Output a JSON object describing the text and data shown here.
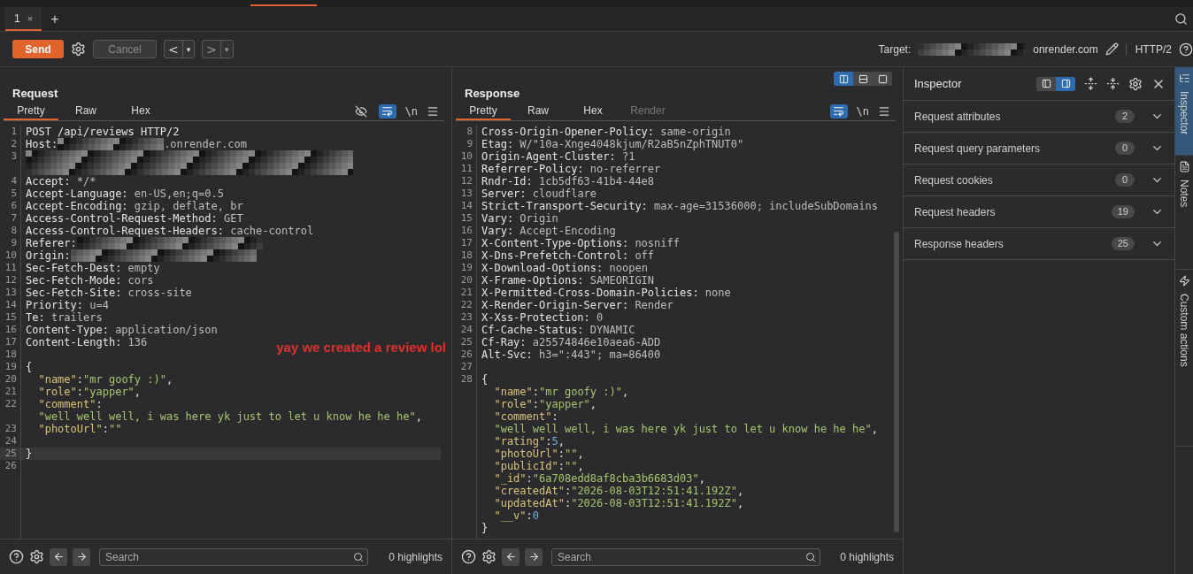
{
  "tabs": [
    {
      "label": "1",
      "close": "×",
      "selected": true
    }
  ],
  "new_tab": "+",
  "toolbar": {
    "send": "Send",
    "cancel": {
      "label": "Cancel",
      "disabled": true
    },
    "back": "<",
    "forward": ">",
    "dropdown": "▾",
    "target_label": "Target:",
    "target_host": "onrender.com",
    "protocol": "HTTP/2"
  },
  "request": {
    "title": "Request",
    "tabs": [
      {
        "label": "Pretty",
        "selected": true,
        "disabled": false
      },
      {
        "label": "Raw",
        "selected": false,
        "disabled": false
      },
      {
        "label": "Hex",
        "selected": false,
        "disabled": false
      }
    ],
    "hide_nonprintable": true,
    "wrap_on": true,
    "newline_label": "\\n",
    "lines": [
      {
        "num": "1",
        "highlighted": false,
        "parts": [
          {
            "kind": "name",
            "t": "POST /api/reviews HTTP/2"
          }
        ]
      },
      {
        "num": "2",
        "highlighted": false,
        "parts": [
          {
            "kind": "name",
            "t": "Host:"
          },
          {
            "kind": "redacted"
          },
          {
            "kind": "value",
            "t": ".onrender.com"
          }
        ]
      },
      {
        "num": "3",
        "highlighted": false,
        "parts": [
          {
            "kind": "redacted"
          }
        ]
      },
      {
        "num": "4",
        "highlighted": false,
        "parts": [
          {
            "kind": "name",
            "t": "Accept:"
          },
          {
            "kind": "value",
            "t": " */*"
          }
        ]
      },
      {
        "num": "5",
        "highlighted": false,
        "parts": [
          {
            "kind": "name",
            "t": "Accept-Language:"
          },
          {
            "kind": "value",
            "t": " en-US,en;q=0.5"
          }
        ]
      },
      {
        "num": "6",
        "highlighted": false,
        "parts": [
          {
            "kind": "name",
            "t": "Accept-Encoding:"
          },
          {
            "kind": "value",
            "t": " gzip, deflate, br"
          }
        ]
      },
      {
        "num": "7",
        "highlighted": false,
        "parts": [
          {
            "kind": "name",
            "t": "Access-Control-Request-Method:"
          },
          {
            "kind": "value",
            "t": " GET"
          }
        ]
      },
      {
        "num": "8",
        "highlighted": false,
        "parts": [
          {
            "kind": "name",
            "t": "Access-Control-Request-Headers:"
          },
          {
            "kind": "value",
            "t": " cache-control"
          }
        ]
      },
      {
        "num": "9",
        "highlighted": false,
        "parts": [
          {
            "kind": "name",
            "t": "Referer:"
          },
          {
            "kind": "redacted"
          }
        ]
      },
      {
        "num": "10",
        "highlighted": false,
        "parts": [
          {
            "kind": "name",
            "t": "Origin:"
          },
          {
            "kind": "redacted"
          }
        ]
      },
      {
        "num": "11",
        "highlighted": false,
        "parts": [
          {
            "kind": "name",
            "t": "Sec-Fetch-Dest:"
          },
          {
            "kind": "value",
            "t": " empty"
          }
        ]
      },
      {
        "num": "12",
        "highlighted": false,
        "parts": [
          {
            "kind": "name",
            "t": "Sec-Fetch-Mode:"
          },
          {
            "kind": "value",
            "t": " cors"
          }
        ]
      },
      {
        "num": "13",
        "highlighted": false,
        "parts": [
          {
            "kind": "name",
            "t": "Sec-Fetch-Site:"
          },
          {
            "kind": "value",
            "t": " cross-site"
          }
        ]
      },
      {
        "num": "14",
        "highlighted": false,
        "parts": [
          {
            "kind": "name",
            "t": "Priority:"
          },
          {
            "kind": "value",
            "t": " u=4"
          }
        ]
      },
      {
        "num": "15",
        "highlighted": false,
        "parts": [
          {
            "kind": "name",
            "t": "Te:"
          },
          {
            "kind": "value",
            "t": " trailers"
          }
        ]
      },
      {
        "num": "16",
        "highlighted": false,
        "parts": [
          {
            "kind": "name",
            "t": "Content-Type:"
          },
          {
            "kind": "value",
            "t": " application/json"
          }
        ]
      },
      {
        "num": "17",
        "highlighted": false,
        "parts": [
          {
            "kind": "name",
            "t": "Content-Length:"
          },
          {
            "kind": "value",
            "t": " 136"
          }
        ]
      },
      {
        "num": "18",
        "highlighted": false
      },
      {
        "num": "19",
        "highlighted": false,
        "parts": [
          {
            "kind": "punct",
            "t": "{"
          }
        ]
      },
      {
        "num": "20",
        "highlighted": false,
        "parts": [
          {
            "kind": "jkey",
            "t": "  \"name\""
          },
          {
            "kind": "punct",
            "t": ":"
          },
          {
            "kind": "jstr",
            "t": "\"mr goofy :)\""
          },
          {
            "kind": "punct",
            "t": ","
          }
        ]
      },
      {
        "num": "21",
        "highlighted": false,
        "parts": [
          {
            "kind": "jkey",
            "t": "  \"role\""
          },
          {
            "kind": "punct",
            "t": ":"
          },
          {
            "kind": "jstr",
            "t": "\"yapper\""
          },
          {
            "kind": "punct",
            "t": ","
          }
        ]
      },
      {
        "num": "22",
        "highlighted": false,
        "parts": [
          {
            "kind": "jkey",
            "t": "  \"comment\""
          },
          {
            "kind": "punct",
            "t": ":"
          }
        ]
      },
      {
        "highlighted": false,
        "parts": [
          {
            "kind": "jstr",
            "t": "  \"well well well, i was here yk just to let u know he he he\""
          },
          {
            "kind": "punct",
            "t": ","
          }
        ]
      },
      {
        "num": "23",
        "highlighted": false,
        "parts": [
          {
            "kind": "jkey",
            "t": "  \"photoUrl\""
          },
          {
            "kind": "punct",
            "t": ":"
          },
          {
            "kind": "jstr",
            "t": "\"\""
          }
        ]
      },
      {
        "num": "24",
        "highlighted": false
      },
      {
        "num": "25",
        "highlighted": true,
        "parts": [
          {
            "kind": "punct",
            "t": "}"
          }
        ]
      },
      {
        "num": "26",
        "highlighted": false
      }
    ],
    "annotation": "yay we created a review lol",
    "search": {
      "placeholder": "Search"
    },
    "highlights": "0 highlights"
  },
  "response": {
    "title": "Response",
    "layout_modes": [
      {
        "kind": "side-by-side",
        "selected": true
      },
      {
        "kind": "stacked",
        "selected": false
      },
      {
        "kind": "single",
        "selected": false
      }
    ],
    "tabs": [
      {
        "label": "Pretty",
        "selected": true,
        "disabled": false
      },
      {
        "label": "Raw",
        "selected": false,
        "disabled": false
      },
      {
        "label": "Hex",
        "selected": false,
        "disabled": false
      },
      {
        "label": "Render",
        "selected": false,
        "disabled": true
      }
    ],
    "wrap_on": true,
    "newline_label": "\\n",
    "lines": [
      {
        "num": "8",
        "highlighted": false,
        "parts": [
          {
            "kind": "name",
            "t": "Cross-Origin-Opener-Policy:"
          },
          {
            "kind": "value",
            "t": " same-origin"
          }
        ]
      },
      {
        "num": "9",
        "highlighted": false,
        "parts": [
          {
            "kind": "name",
            "t": "Etag:"
          },
          {
            "kind": "value",
            "t": " W/\"10a-Xnge4048kjum/R2aB5nZphTNUT0\""
          }
        ]
      },
      {
        "num": "10",
        "highlighted": false,
        "parts": [
          {
            "kind": "name",
            "t": "Origin-Agent-Cluster:"
          },
          {
            "kind": "value",
            "t": " ?1"
          }
        ]
      },
      {
        "num": "11",
        "highlighted": false,
        "parts": [
          {
            "kind": "name",
            "t": "Referrer-Policy:"
          },
          {
            "kind": "value",
            "t": " no-referrer"
          }
        ]
      },
      {
        "num": "12",
        "highlighted": false,
        "parts": [
          {
            "kind": "name",
            "t": "Rndr-Id:"
          },
          {
            "kind": "value",
            "t": " 1cb5df63-41b4-44e8"
          }
        ]
      },
      {
        "num": "13",
        "highlighted": false,
        "parts": [
          {
            "kind": "name",
            "t": "Server:"
          },
          {
            "kind": "value",
            "t": " cloudflare"
          }
        ]
      },
      {
        "num": "14",
        "highlighted": false,
        "parts": [
          {
            "kind": "name",
            "t": "Strict-Transport-Security:"
          },
          {
            "kind": "value",
            "t": " max-age=31536000; includeSubDomains"
          }
        ]
      },
      {
        "num": "15",
        "highlighted": false,
        "parts": [
          {
            "kind": "name",
            "t": "Vary:"
          },
          {
            "kind": "value",
            "t": " Origin"
          }
        ]
      },
      {
        "num": "16",
        "highlighted": false,
        "parts": [
          {
            "kind": "name",
            "t": "Vary:"
          },
          {
            "kind": "value",
            "t": " Accept-Encoding"
          }
        ]
      },
      {
        "num": "17",
        "highlighted": false,
        "parts": [
          {
            "kind": "name",
            "t": "X-Content-Type-Options:"
          },
          {
            "kind": "value",
            "t": " nosniff"
          }
        ]
      },
      {
        "num": "18",
        "highlighted": false,
        "parts": [
          {
            "kind": "name",
            "t": "X-Dns-Prefetch-Control:"
          },
          {
            "kind": "value",
            "t": " off"
          }
        ]
      },
      {
        "num": "19",
        "highlighted": false,
        "parts": [
          {
            "kind": "name",
            "t": "X-Download-Options:"
          },
          {
            "kind": "value",
            "t": " noopen"
          }
        ]
      },
      {
        "num": "20",
        "highlighted": false,
        "parts": [
          {
            "kind": "name",
            "t": "X-Frame-Options:"
          },
          {
            "kind": "value",
            "t": " SAMEORIGIN"
          }
        ]
      },
      {
        "num": "21",
        "highlighted": false,
        "parts": [
          {
            "kind": "name",
            "t": "X-Permitted-Cross-Domain-Policies:"
          },
          {
            "kind": "value",
            "t": " none"
          }
        ]
      },
      {
        "num": "22",
        "highlighted": false,
        "parts": [
          {
            "kind": "name",
            "t": "X-Render-Origin-Server:"
          },
          {
            "kind": "value",
            "t": " Render"
          }
        ]
      },
      {
        "num": "23",
        "highlighted": false,
        "parts": [
          {
            "kind": "name",
            "t": "X-Xss-Protection:"
          },
          {
            "kind": "value",
            "t": " 0"
          }
        ]
      },
      {
        "num": "24",
        "highlighted": false,
        "parts": [
          {
            "kind": "name",
            "t": "Cf-Cache-Status:"
          },
          {
            "kind": "value",
            "t": " DYNAMIC"
          }
        ]
      },
      {
        "num": "25",
        "highlighted": false,
        "parts": [
          {
            "kind": "name",
            "t": "Cf-Ray:"
          },
          {
            "kind": "value",
            "t": " a25574846e10aea6-ADD"
          }
        ]
      },
      {
        "num": "26",
        "highlighted": false,
        "parts": [
          {
            "kind": "name",
            "t": "Alt-Svc:"
          },
          {
            "kind": "value",
            "t": " h3=\":443\"; ma=86400"
          }
        ]
      },
      {
        "num": "27",
        "highlighted": false
      },
      {
        "num": "28",
        "highlighted": false,
        "parts": [
          {
            "kind": "punct",
            "t": "{"
          }
        ]
      },
      {
        "highlighted": false,
        "parts": [
          {
            "kind": "jkey",
            "t": "  \"name\""
          },
          {
            "kind": "punct",
            "t": ":"
          },
          {
            "kind": "jstr",
            "t": "\"mr goofy :)\""
          },
          {
            "kind": "punct",
            "t": ","
          }
        ]
      },
      {
        "highlighted": false,
        "parts": [
          {
            "kind": "jkey",
            "t": "  \"role\""
          },
          {
            "kind": "punct",
            "t": ":"
          },
          {
            "kind": "jstr",
            "t": "\"yapper\""
          },
          {
            "kind": "punct",
            "t": ","
          }
        ]
      },
      {
        "highlighted": false,
        "parts": [
          {
            "kind": "jkey",
            "t": "  \"comment\""
          },
          {
            "kind": "punct",
            "t": ":"
          }
        ]
      },
      {
        "highlighted": false,
        "parts": [
          {
            "kind": "jstr",
            "t": "  \"well well well, i was here yk just to let u know he he he\""
          },
          {
            "kind": "punct",
            "t": ","
          }
        ]
      },
      {
        "highlighted": false,
        "parts": [
          {
            "kind": "jkey",
            "t": "  \"rating\""
          },
          {
            "kind": "punct",
            "t": ":"
          },
          {
            "kind": "jnum",
            "t": "5"
          },
          {
            "kind": "punct",
            "t": ","
          }
        ]
      },
      {
        "highlighted": false,
        "parts": [
          {
            "kind": "jkey",
            "t": "  \"photoUrl\""
          },
          {
            "kind": "punct",
            "t": ":"
          },
          {
            "kind": "jstr",
            "t": "\"\""
          },
          {
            "kind": "punct",
            "t": ","
          }
        ]
      },
      {
        "highlighted": false,
        "parts": [
          {
            "kind": "jkey",
            "t": "  \"publicId\""
          },
          {
            "kind": "punct",
            "t": ":"
          },
          {
            "kind": "jstr",
            "t": "\"\""
          },
          {
            "kind": "punct",
            "t": ","
          }
        ]
      },
      {
        "highlighted": false,
        "parts": [
          {
            "kind": "jkey",
            "t": "  \"_id\""
          },
          {
            "kind": "punct",
            "t": ":"
          },
          {
            "kind": "jstr",
            "t": "\"6a708edd8af8cba3b6683d03\""
          },
          {
            "kind": "punct",
            "t": ","
          }
        ]
      },
      {
        "highlighted": false,
        "parts": [
          {
            "kind": "jkey",
            "t": "  \"createdAt\""
          },
          {
            "kind": "punct",
            "t": ":"
          },
          {
            "kind": "jstr",
            "t": "\"2026-08-03T12:51:41.192Z\""
          },
          {
            "kind": "punct",
            "t": ","
          }
        ]
      },
      {
        "highlighted": false,
        "parts": [
          {
            "kind": "jkey",
            "t": "  \"updatedAt\""
          },
          {
            "kind": "punct",
            "t": ":"
          },
          {
            "kind": "jstr",
            "t": "\"2026-08-03T12:51:41.192Z\""
          },
          {
            "kind": "punct",
            "t": ","
          }
        ]
      },
      {
        "highlighted": false,
        "parts": [
          {
            "kind": "jkey",
            "t": "  \"__v\""
          },
          {
            "kind": "punct",
            "t": ":"
          },
          {
            "kind": "jnum",
            "t": "0"
          }
        ]
      },
      {
        "highlighted": false,
        "parts": [
          {
            "kind": "punct",
            "t": "}"
          }
        ]
      }
    ],
    "search": {
      "placeholder": "Search"
    },
    "highlights": "0 highlights"
  },
  "inspector": {
    "title": "Inspector",
    "view_modes": [
      {
        "kind": "left",
        "selected": false
      },
      {
        "kind": "right",
        "selected": true
      }
    ],
    "sections": [
      {
        "label": "Request attributes",
        "count": "2",
        "expanded": false
      },
      {
        "label": "Request query parameters",
        "count": "0",
        "expanded": false
      },
      {
        "label": "Request cookies",
        "count": "0",
        "expanded": false
      },
      {
        "label": "Request headers",
        "count": "19",
        "expanded": false
      },
      {
        "label": "Response headers",
        "count": "25",
        "expanded": false
      }
    ]
  },
  "side_tabs": [
    {
      "kind": "inspector",
      "label": "Inspector",
      "selected": true
    },
    {
      "kind": "notes",
      "label": "Notes",
      "selected": false
    },
    {
      "kind": "actions",
      "label": "Custom actions",
      "selected": false
    }
  ]
}
